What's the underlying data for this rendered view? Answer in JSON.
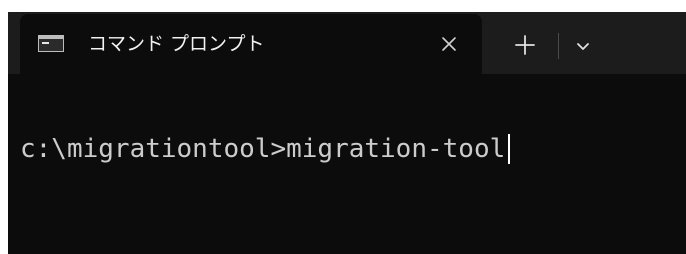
{
  "window": {
    "tab": {
      "icon": "command-prompt-icon",
      "title": "コマンド プロンプト",
      "close_icon": "close-icon"
    },
    "new_tab_icon": "plus-icon",
    "dropdown_icon": "chevron-down-icon"
  },
  "terminal": {
    "prompt": "c:\\migrationtool>",
    "command": "migration-tool"
  },
  "colors": {
    "titlebar": "#1c1c1c",
    "terminal_background": "#0c0c0c",
    "text": "#cccccc"
  }
}
